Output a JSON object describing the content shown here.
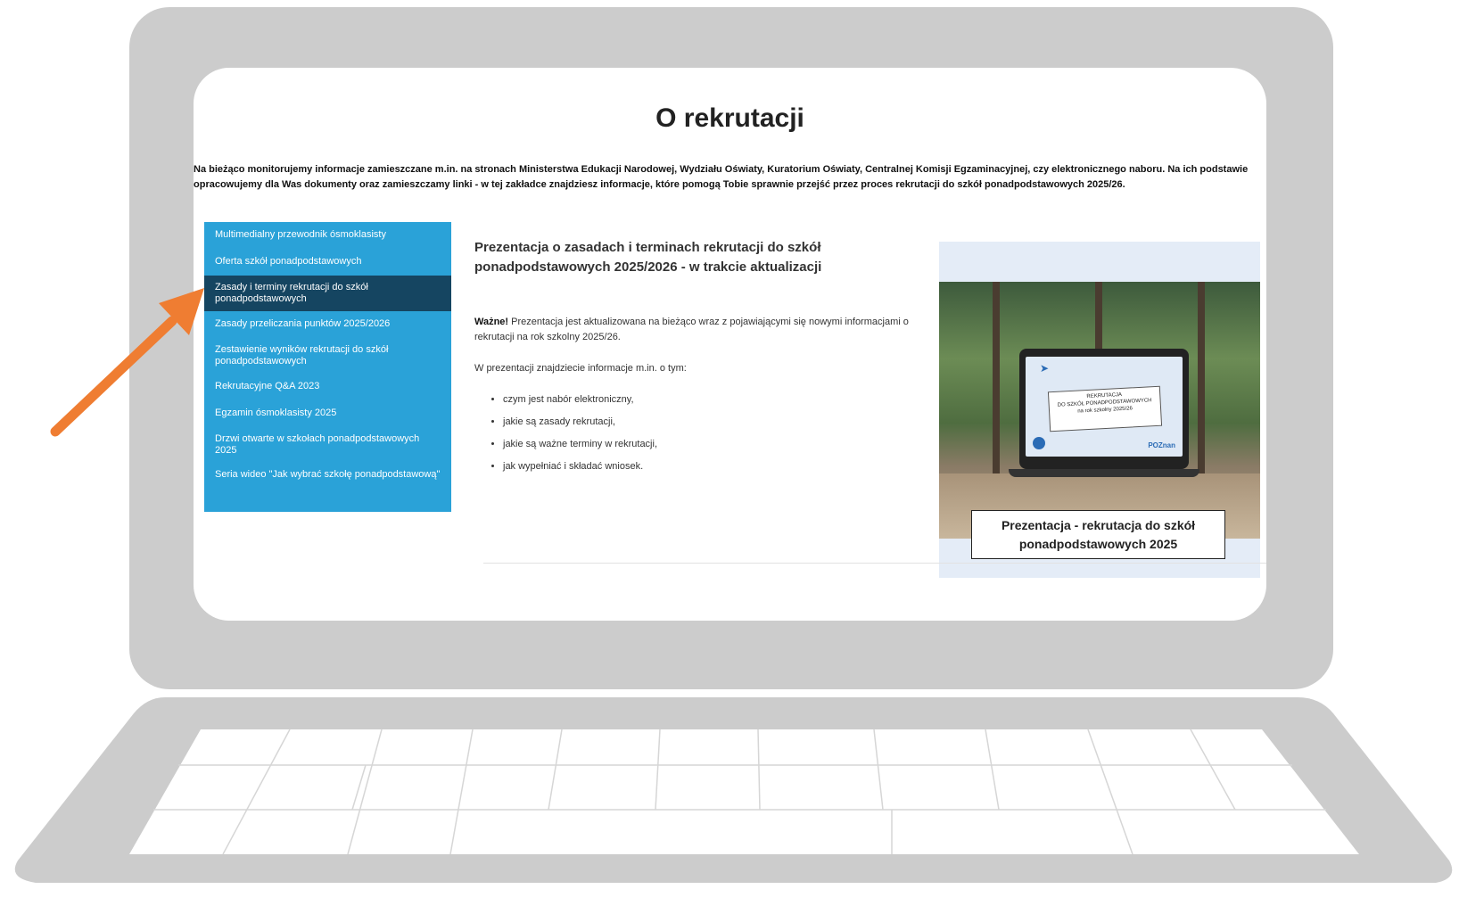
{
  "page": {
    "title": "O rekrutacji",
    "intro": "Na bieżąco monitorujemy informacje zamieszczane m.in. na stronach Ministerstwa Edukacji Narodowej, Wydziału Oświaty, Kuratorium Oświaty, Centralnej Komisji Egzaminacyjnej, czy elektronicznego naboru. Na ich podstawie opracowujemy dla Was dokumenty oraz zamieszczamy linki - w tej zakładce znajdziesz informacje, które pomogą Tobie sprawnie przejść przez proces rekrutacji do szkół ponadpodstawowych 2025/26."
  },
  "sidebar": {
    "items": [
      {
        "label": "Multimedialny przewodnik ósmoklasisty",
        "active": false
      },
      {
        "label": "Oferta szkół ponadpodstawowych",
        "active": false
      },
      {
        "label": "Zasady i terminy rekrutacji do szkół ponadpodstawowych",
        "active": true
      },
      {
        "label": "Zasady przeliczania punktów 2025/2026",
        "active": false
      },
      {
        "label": "Zestawienie wyników rekrutacji do szkół ponadpodstawowych",
        "active": false
      },
      {
        "label": "Rekrutacyjne Q&A 2023",
        "active": false
      },
      {
        "label": "Egzamin ósmoklasisty 2025",
        "active": false
      },
      {
        "label": "Drzwi otwarte w szkołach ponadpodstawowych 2025",
        "active": false
      },
      {
        "label": "Seria wideo \"Jak wybrać szkołę ponadpodstawową\"",
        "active": false
      }
    ]
  },
  "content": {
    "title": "Prezentacja o zasadach i terminach rekrutacji do szkół ponadpodstawowych 2025/2026 - w trakcie aktualizacji",
    "note_bold": "Ważne!",
    "note_text": " Prezentacja jest aktualizowana na bieżąco wraz z pojawiającymi się nowymi informacjami o rekrutacji na rok szkolny 2025/26.",
    "para": "W prezentacji znajdziecie informacje m.in. o tym:",
    "bullets": [
      "czym jest nabór elektroniczny,",
      "jakie są zasady rekrutacji,",
      "jakie są ważne terminy w rekrutacji,",
      "jak wypełniać i składać wniosek."
    ]
  },
  "promo": {
    "slide_line1": "REKRUTACJA",
    "slide_line2": "DO SZKÓŁ PONADPODSTAWOWYCH",
    "slide_line3": "na rok szkolny 2025/26",
    "slide_brand": "POZnan",
    "caption": "Prezentacja - rekrutacja do szkół ponadpodstawowych 2025"
  },
  "colors": {
    "sidebar_bg": "#2aa2d8",
    "sidebar_active_bg": "#154561",
    "arrow": "#ef7d32",
    "laptop_frame": "#cccccc"
  },
  "icons": {
    "pointer": "arrow-icon"
  }
}
